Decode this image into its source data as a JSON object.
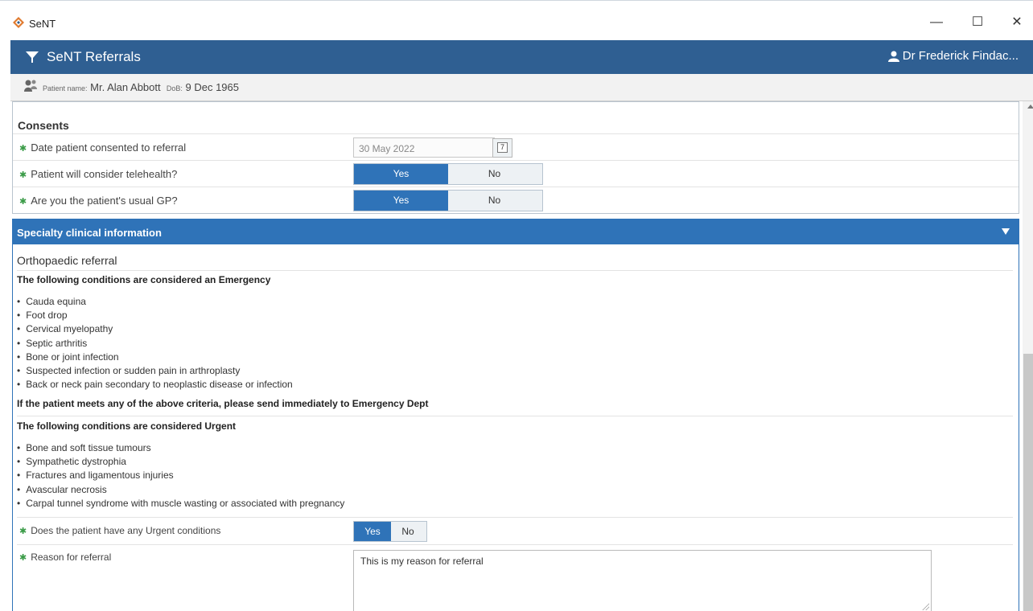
{
  "window": {
    "app_name": "SeNT",
    "minimize": "—",
    "maximize": "☐",
    "close": "✕"
  },
  "header": {
    "title": "SeNT Referrals",
    "user": "Dr Frederick Findac..."
  },
  "patient": {
    "name_label": "Patient name:",
    "name": "Mr. Alan Abbott",
    "dob_label": "DoB:",
    "dob": "9 Dec 1965"
  },
  "consents": {
    "title": "Consents",
    "date_question": "Date patient consented to referral",
    "date_value": "30 May 2022",
    "calendar_day": "7",
    "telehealth_question": "Patient will consider telehealth?",
    "usual_gp_question": "Are you the patient's usual GP?",
    "yes": "Yes",
    "no": "No"
  },
  "specialty": {
    "header": "Specialty clinical information",
    "subtitle": "Orthopaedic referral",
    "emergency_heading": "The following conditions are considered an Emergency",
    "emergency_items": [
      "Cauda equina",
      "Foot drop",
      "Cervical myelopathy",
      "Septic arthritis",
      "Bone or joint infection",
      "Suspected infection or sudden pain in arthroplasty",
      "Back or neck pain secondary to neoplastic disease or infection"
    ],
    "emergency_instruction": "If the patient meets any of the above criteria, please send immediately to Emergency Dept",
    "urgent_heading": "The following conditions are considered Urgent",
    "urgent_items": [
      "Bone and soft tissue tumours",
      "Sympathetic dystrophia",
      "Fractures and ligamentous injuries",
      "Avascular necrosis",
      "Carpal tunnel syndrome with muscle wasting or associated with pregnancy"
    ],
    "urgent_question": "Does the patient have any Urgent conditions",
    "reason_label": "Reason for referral",
    "reason_value": "This is my reason for referral",
    "yes": "Yes",
    "no": "No"
  },
  "required_mark": "✱",
  "colors": {
    "header": "#2f5f92",
    "accent": "#2f73b8",
    "required": "#3a9b47"
  }
}
